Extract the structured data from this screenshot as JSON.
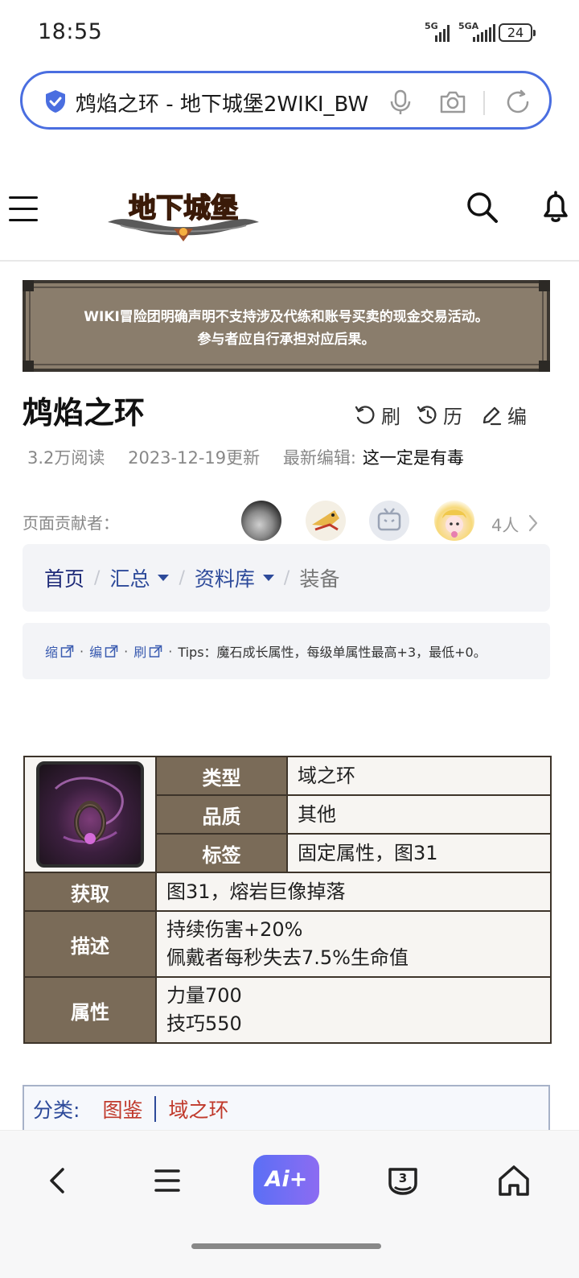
{
  "status_bar": {
    "time": "18:55",
    "signal1": "5G",
    "signal2": "5GA",
    "battery": "24"
  },
  "browser": {
    "url_text": "鸩焰之环 - 地下城堡2WIKI_BW",
    "accent_color": "#4a6ee0"
  },
  "site": {
    "logo_text": "地下城堡"
  },
  "notice": {
    "line1": "WIKI冒险团明确声明不支持涉及代练和账号买卖的现金交易活动。",
    "line2": "参与者应自行承担对应后果。"
  },
  "page": {
    "title": "鸩焰之环",
    "actions": {
      "refresh": "刷",
      "history": "历",
      "edit": "编"
    },
    "meta": {
      "reads": "3.2万阅读",
      "updated": "2023-12-19更新",
      "last_editor_label": "最新编辑:",
      "last_editor": "这一定是有毒"
    },
    "contributors": {
      "label": "页面贡献者：",
      "count": "4人"
    }
  },
  "breadcrumb": [
    {
      "label": "首页"
    },
    {
      "label": "汇总"
    },
    {
      "label": "资料库"
    },
    {
      "label": "装备"
    }
  ],
  "tools": {
    "collapse": "缩",
    "edit": "编",
    "refresh": "刷",
    "tips": "Tips：魔石成长属性，每级单属性最高+3，最低+0。"
  },
  "item": {
    "rows": [
      {
        "key": "类型",
        "value": "域之环"
      },
      {
        "key": "品质",
        "value": "其他"
      },
      {
        "key": "标签",
        "value": "固定属性，图31"
      },
      {
        "key": "获取",
        "value": "图31，熔岩巨像掉落"
      },
      {
        "key": "描述",
        "lines": [
          "持续伤害+20%",
          "佩戴者每秒失去7.5%生命值"
        ]
      },
      {
        "key": "属性",
        "lines": [
          "力量700",
          "技巧550"
        ]
      }
    ]
  },
  "category": {
    "label": "分类:",
    "links": [
      "图鉴",
      "域之环"
    ]
  },
  "bottom_nav": {
    "ai_label": "Ai+",
    "tabs_count": "3"
  }
}
